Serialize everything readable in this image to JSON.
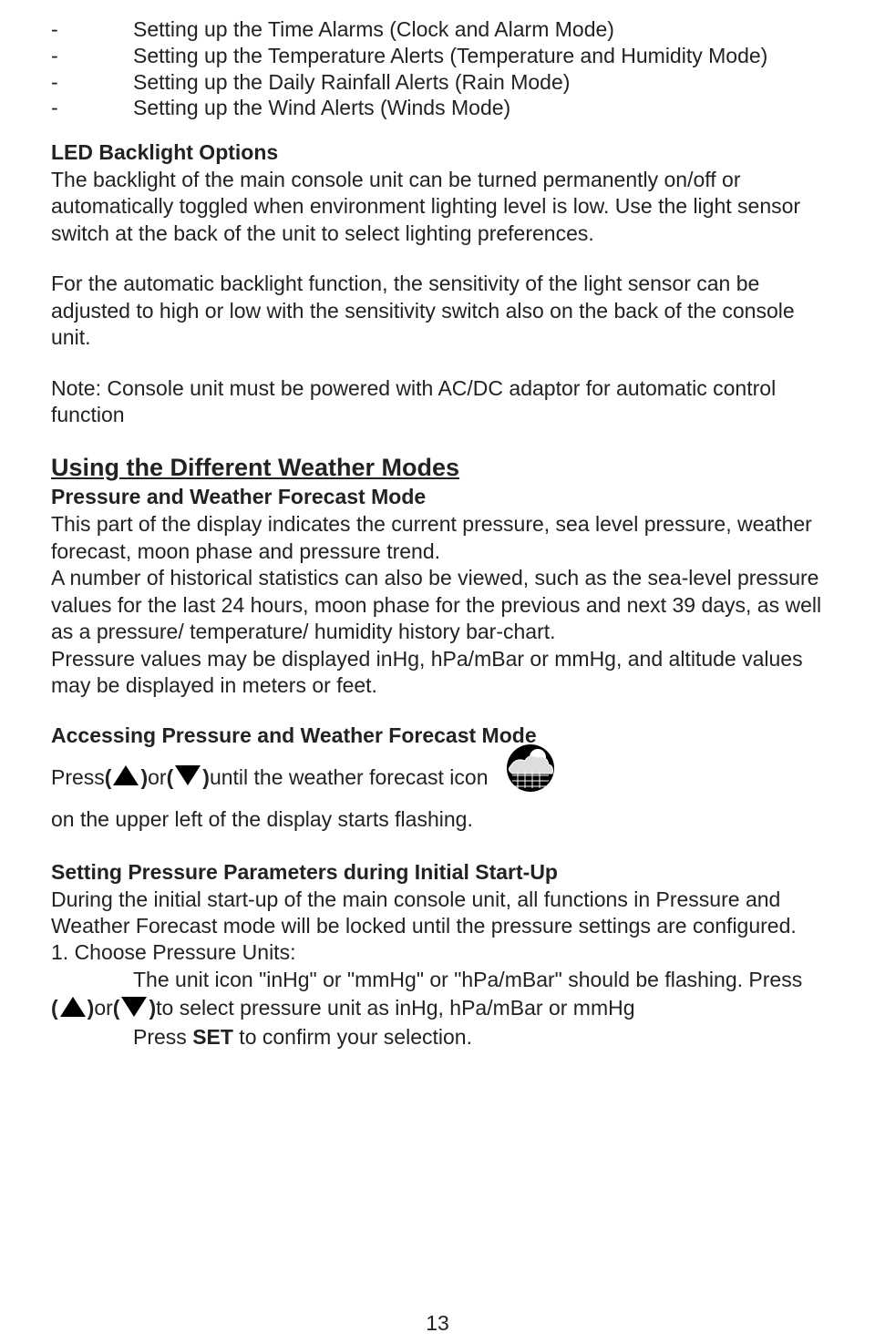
{
  "bullets": [
    "Setting up the Time Alarms (Clock and Alarm Mode)",
    "Setting up the Temperature Alerts (Temperature and Humidity Mode)",
    "Setting up the Daily Rainfall Alerts (Rain Mode)",
    "Setting up the Wind Alerts (Winds Mode)"
  ],
  "dash": "-",
  "led": {
    "heading": "LED Backlight Options",
    "p1": "The backlight of the main console unit can be turned permanently on/off or automatically toggled when environment lighting level is low. Use the light sensor switch at the back of the unit to select lighting preferences.",
    "p2": "For the automatic backlight function, the sensitivity of the light sensor can be adjusted to high or low with the sensitivity switch also on the back of the console unit.",
    "note": "Note: Console unit must be powered with AC/DC adaptor for automatic control function"
  },
  "modes": {
    "heading": "Using the Different Weather Modes",
    "sub1": "Pressure and Weather Forecast Mode",
    "p1": "This part of the display indicates the current pressure, sea level pressure, weather forecast, moon phase and pressure trend.",
    "p2": "A number of historical statistics can also be viewed, such as the sea-level pressure values for the last 24 hours, moon phase for the previous and next 39 days, as well as a pressure/ temperature/ humidity history bar-chart.",
    "p3": "Pressure values may be displayed inHg, hPa/mBar or mmHg, and altitude values may be displayed in meters or feet."
  },
  "access": {
    "heading": "Accessing Pressure and Weather Forecast Mode",
    "press_label": "Press ",
    "paren_open": "(",
    "paren_close": ")",
    "or": " or ",
    "text_after_icons": " until the weather forecast icon ",
    "text_tail": " on the upper left of the display starts flashing."
  },
  "initial": {
    "heading": "Setting Pressure Parameters during Initial Start-Up",
    "p1": "During the initial start-up of the main console unit, all functions in Pressure and Weather Forecast mode will be locked until the pressure settings are configured.",
    "step1_label": "1. Choose Pressure Units:",
    "step1_line1": "The unit icon \"inHg\" or \"mmHg\" or \"hPa/mBar\" should be flashing. Press",
    "press_paren_open": "(",
    "press_paren_close": ")",
    "press_or": " or ",
    "step1_tail": " to select pressure unit as inHg, hPa/mBar or mmHg",
    "step1_confirm_pre": "Press ",
    "step1_set": "SET",
    "step1_confirm_post": " to confirm your selection."
  },
  "page_number": "13"
}
